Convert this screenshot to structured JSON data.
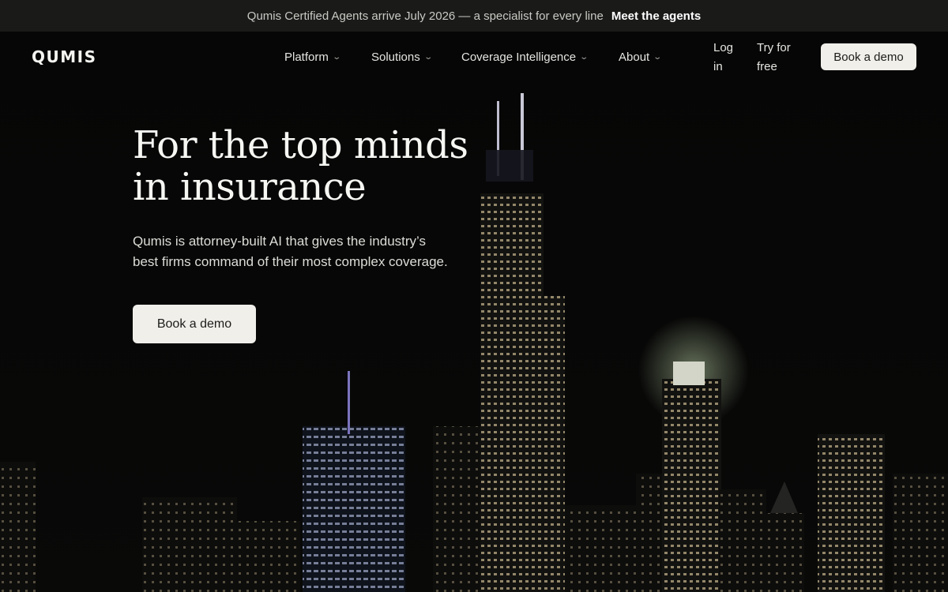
{
  "announcement": {
    "text": "Qumis Certified Agents arrive July 2026 — a specialist for every line",
    "link": "Meet the agents"
  },
  "nav": {
    "logo": "QUMIS",
    "items": [
      {
        "label": "Platform",
        "icon": "chevron-down-icon"
      },
      {
        "label": "Solutions",
        "icon": "chevron-down-icon"
      },
      {
        "label": "Coverage Intelligence",
        "icon": "chevron-down-icon"
      },
      {
        "label": "About",
        "icon": "chevron-down-icon"
      }
    ],
    "login": [
      "Log",
      "in"
    ],
    "try_free": [
      "Try for",
      "free"
    ],
    "cta": "Book a demo"
  },
  "hero": {
    "headline": [
      "For the top minds",
      "in insurance"
    ],
    "subtext": [
      "Qumis is attorney-built AI that gives the industry’s",
      "best firms command of their most complex coverage."
    ],
    "cta": "Book a demo",
    "background": "night city skyline"
  },
  "colors": {
    "background": "#060606",
    "announcement_bar": "#1a1a19",
    "button": "#f0efea",
    "button_text": "#1c1c1a"
  }
}
